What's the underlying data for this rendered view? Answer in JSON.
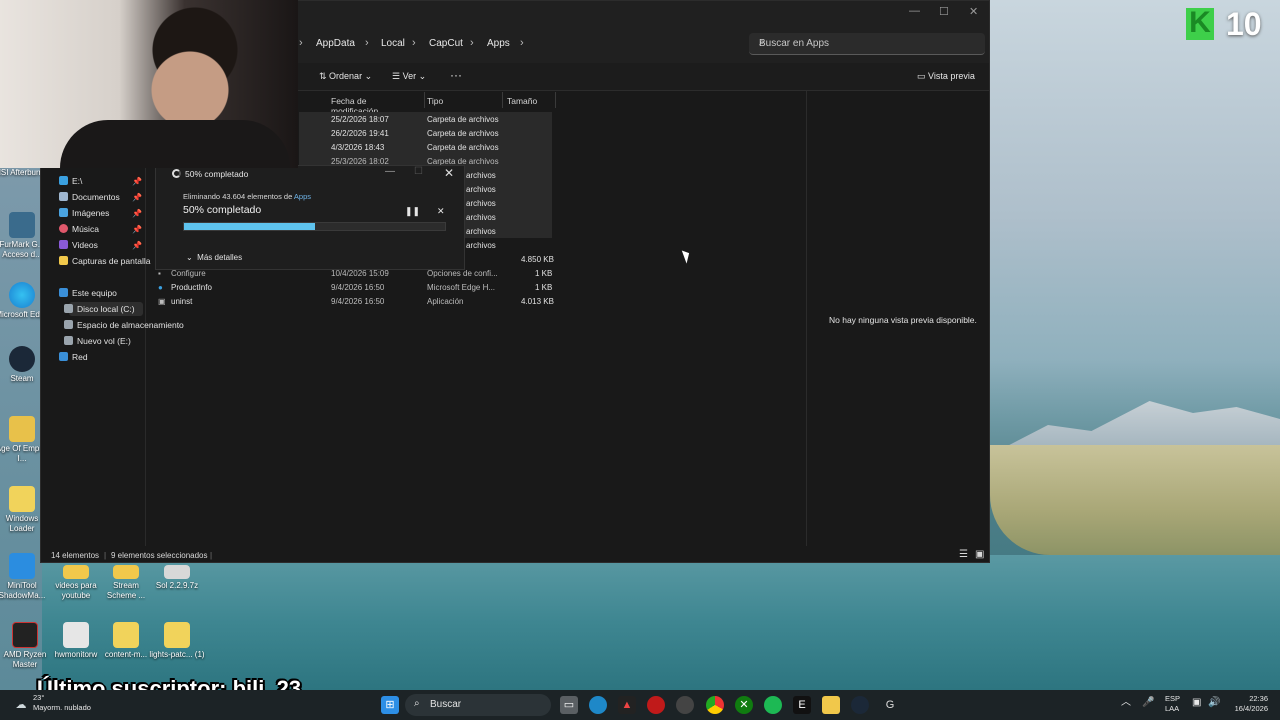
{
  "breadcrumb": [
    "AppData",
    "Local",
    "CapCut",
    "Apps"
  ],
  "search": {
    "placeholder": "Buscar en Apps"
  },
  "toolbar": {
    "sort_label": "Ordenar",
    "view_label": "Ver",
    "more_label": "···",
    "preview_label": "Vista previa"
  },
  "nav": {
    "items": [
      {
        "label": "E:\\",
        "pinned": true
      },
      {
        "label": "Documentos",
        "pinned": true
      },
      {
        "label": "Imágenes",
        "pinned": true
      },
      {
        "label": "Música",
        "pinned": true
      },
      {
        "label": "Videos",
        "pinned": true
      },
      {
        "label": "Capturas de pantalla",
        "pinned": false
      },
      {
        "label": "Este equipo",
        "pinned": false
      },
      {
        "label": "Disco local (C:)",
        "pinned": false
      },
      {
        "label": "Espacio de almacenamiento",
        "pinned": false
      },
      {
        "label": "Nuevo vol (E:)",
        "pinned": false
      },
      {
        "label": "Red",
        "pinned": false
      }
    ]
  },
  "columns": {
    "modified": "Fecha de modificación",
    "type": "Tipo",
    "size": "Tamaño"
  },
  "rows": [
    {
      "date": "25/2/2026 18:07",
      "type": "Carpeta de archivos",
      "size": ""
    },
    {
      "date": "26/2/2026 19:41",
      "type": "Carpeta de archivos",
      "size": ""
    },
    {
      "date": "4/3/2026 18:43",
      "type": "Carpeta de archivos",
      "size": ""
    },
    {
      "date": "25/3/2026 18:02",
      "type": "Carpeta de archivos",
      "size": ""
    },
    {
      "date": "",
      "type": "archivos",
      "size": ""
    },
    {
      "date": "",
      "type": "archivos",
      "size": ""
    },
    {
      "date": "",
      "type": "archivos",
      "size": ""
    },
    {
      "date": "",
      "type": "archivos",
      "size": ""
    },
    {
      "date": "",
      "type": "archivos",
      "size": ""
    },
    {
      "date": "",
      "type": "archivos",
      "size": ""
    }
  ],
  "files": [
    {
      "name": "",
      "date": "",
      "type": "",
      "size": "4.850 KB"
    },
    {
      "name": "Configure",
      "date": "10/4/2026 15:09",
      "type": "Opciones de confi...",
      "size": "1 KB"
    },
    {
      "name": "ProductInfo",
      "date": "9/4/2026 16:50",
      "type": "Microsoft Edge H...",
      "size": "1 KB"
    },
    {
      "name": "uninst",
      "date": "9/4/2026 16:50",
      "type": "Aplicación",
      "size": "4.013 KB"
    }
  ],
  "preview": {
    "message": "No hay ninguna vista previa disponible."
  },
  "status": {
    "count": "14 elementos",
    "selected": "9 elementos seleccionados"
  },
  "dialog": {
    "title": "50% completado",
    "subtitle_prefix": "Eliminando 43.604 elementos de ",
    "subtitle_link": "Apps",
    "percent_text": "50% completado",
    "progress": 0.5,
    "more_details": "Más detalles"
  },
  "desktop_icons": [
    {
      "label": "MSI Afterburn..."
    },
    {
      "label": "FurMark G... Acceso d..."
    },
    {
      "label": "Microsoft Edge"
    },
    {
      "label": "Steam"
    },
    {
      "label": "Age Of Empire I..."
    },
    {
      "label": "Windows Loader"
    },
    {
      "label": "MiniTool ShadowMa..."
    },
    {
      "label": "videos para youtube"
    },
    {
      "label": "Stream Scheme ..."
    },
    {
      "label": "Sol 2.2.9.7z"
    },
    {
      "label": "AMD Ryzen Master"
    },
    {
      "label": "hwmonitorw"
    },
    {
      "label": "content-m..."
    },
    {
      "label": "lights-patc... (1)"
    }
  ],
  "overlay": {
    "logo_letter": "K",
    "logo_number": "10",
    "subscriber": "Último suscriptor: bili_23"
  },
  "taskbar": {
    "search": "Buscar",
    "weather_temp": "23°",
    "weather_desc": "Mayorm. nublado",
    "lang": "ESP",
    "lang2": "LAA",
    "time": "22:36",
    "date": "16/4/2026"
  },
  "colors": {
    "accent": "#5ec3ee",
    "link": "#6fb4e8",
    "window_bg": "#191919",
    "logo_green": "#3ecf4a"
  }
}
